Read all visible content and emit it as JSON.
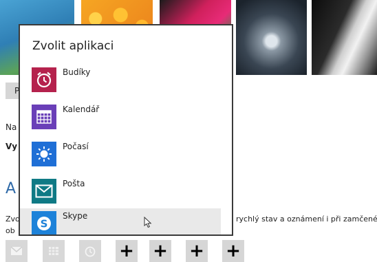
{
  "flyout": {
    "title": "Zvolit aplikaci",
    "apps": [
      {
        "label": "Budíky",
        "icon": "alarm-clock-icon",
        "color": "#b5224d"
      },
      {
        "label": "Kalendář",
        "icon": "calendar-icon",
        "color": "#6a3fb8"
      },
      {
        "label": "Počasí",
        "icon": "sun-icon",
        "color": "#1f6fd6"
      },
      {
        "label": "Pošta",
        "icon": "mail-icon",
        "color": "#0f7a85"
      },
      {
        "label": "Skype",
        "icon": "skype-icon",
        "color": "#1d82d9"
      }
    ]
  },
  "page": {
    "button_fragment": "P",
    "text_na": "Na",
    "text_vy": "Vy",
    "section_fragment": "A",
    "desc_left_1": "Zvo",
    "desc_left_2": "ob",
    "desc_right": "rychlý stav a oznámení i při zamčené"
  },
  "lock_apps": {
    "placeholders": [
      "mail-icon",
      "calendar-icon",
      "alarm-clock-icon"
    ],
    "add_label": "+"
  }
}
